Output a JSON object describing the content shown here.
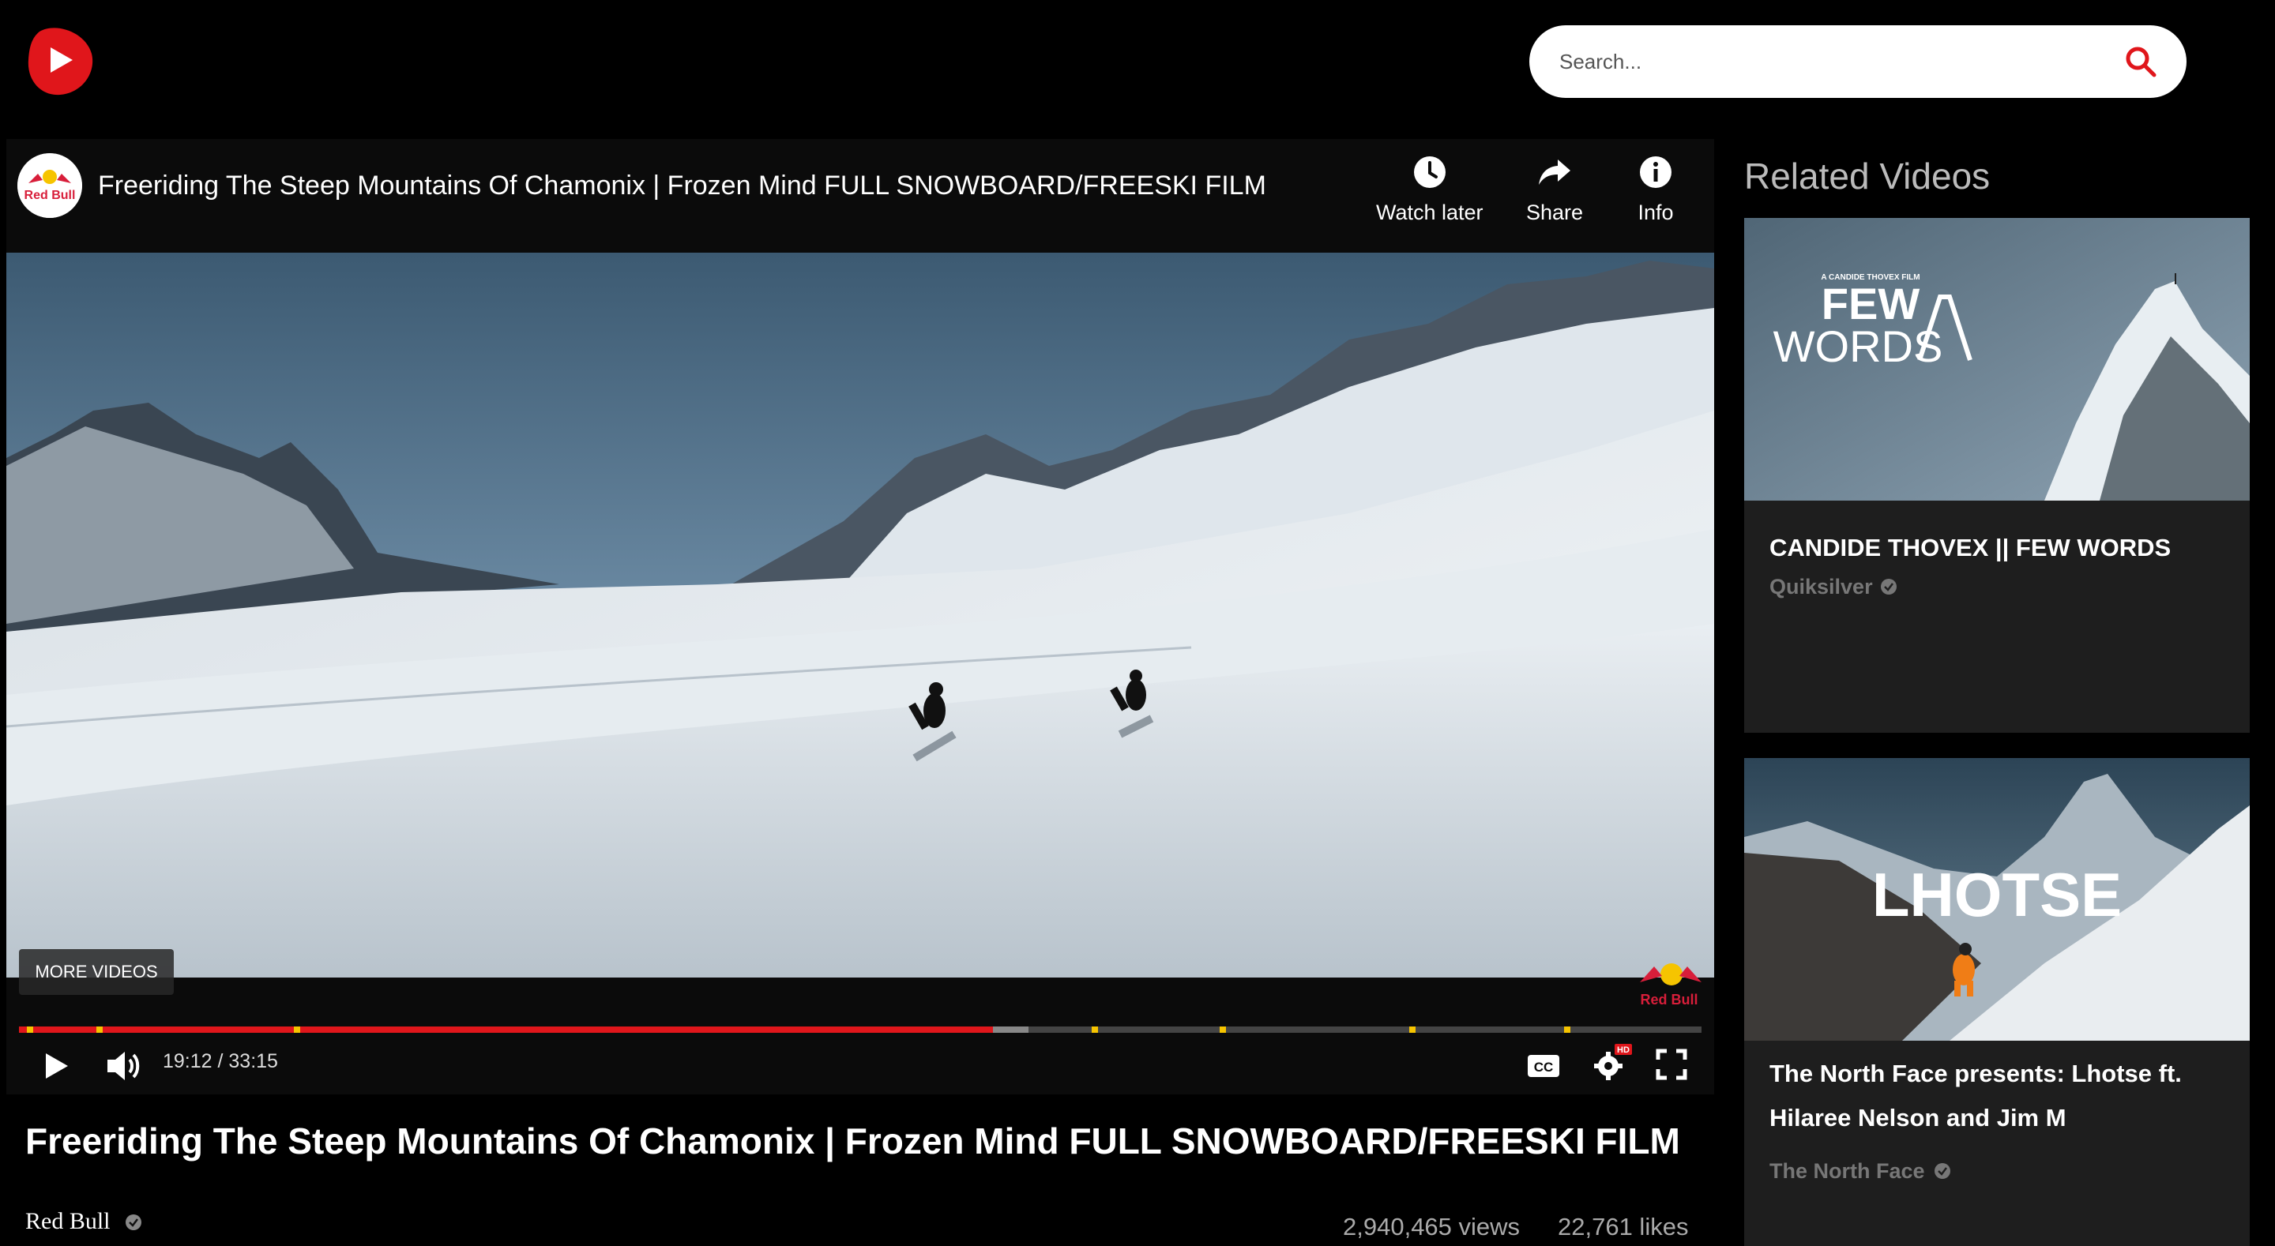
{
  "header": {
    "logo_icon": "play-logo-icon",
    "search_placeholder": "Search..."
  },
  "player": {
    "channel_avatar_text": "Red Bull",
    "title": "Freeriding The Steep Mountains Of Chamonix | Frozen Mind FULL SNOWBOARD/FREESKI FILM",
    "actions": [
      {
        "label": "Watch later",
        "icon": "clock-icon"
      },
      {
        "label": "Share",
        "icon": "share-arrow-icon"
      },
      {
        "label": "Info",
        "icon": "info-icon"
      }
    ],
    "more_videos_label": "MORE VIDEOS",
    "watermark_text": "Red Bull",
    "time": "19:12 / 33:15",
    "progress": {
      "played_fraction": 0.579,
      "buffered_fraction": 0.6
    }
  },
  "video_meta": {
    "title": "Freeriding The Steep Mountains Of Chamonix | Frozen Mind FULL SNOWBOARD/FREESKI FILM",
    "channel": "Red Bull",
    "views": "2,940,465 views",
    "likes": "22,761 likes"
  },
  "related": {
    "heading": "Related Videos",
    "items": [
      {
        "title": "CANDIDE THOVEX || FEW WORDS",
        "channel": "Quiksilver",
        "thumb_small": "A CANDIDE THOVEX FILM",
        "thumb_big1": "FEW",
        "thumb_big2": "WORDS"
      },
      {
        "title_line1": "The North Face presents: Lhotse ft.",
        "title_line2": "Hilaree Nelson and Jim M",
        "channel": "The North Face",
        "thumb_big": "LHOTSE"
      }
    ]
  },
  "colors": {
    "accent": "#e0161b",
    "marker": "#f6c400",
    "card_bg": "#1e1e1e"
  }
}
